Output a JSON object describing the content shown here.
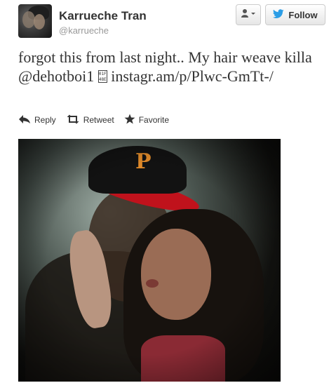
{
  "user": {
    "name": "Karrueche Tran",
    "handle": "@karrueche"
  },
  "buttons": {
    "follow_label": "Follow"
  },
  "tweet": {
    "text_part1": "forgot this from last night.. My hair weave killa @dehotboi1 ",
    "unknown_glyph": "01F 48E",
    "text_part2": " instagr.am/p/Plwc-GmTt-/"
  },
  "actions": {
    "reply": "Reply",
    "retweet": "Retweet",
    "favorite": "Favorite"
  },
  "colors": {
    "twitter_blue": "#2b9de6",
    "cap_red": "#c0121c",
    "text": "#333333",
    "muted": "#999999"
  },
  "icons": [
    "user-dropdown-icon",
    "twitter-bird-icon",
    "reply-icon",
    "retweet-icon",
    "favorite-star-icon"
  ]
}
